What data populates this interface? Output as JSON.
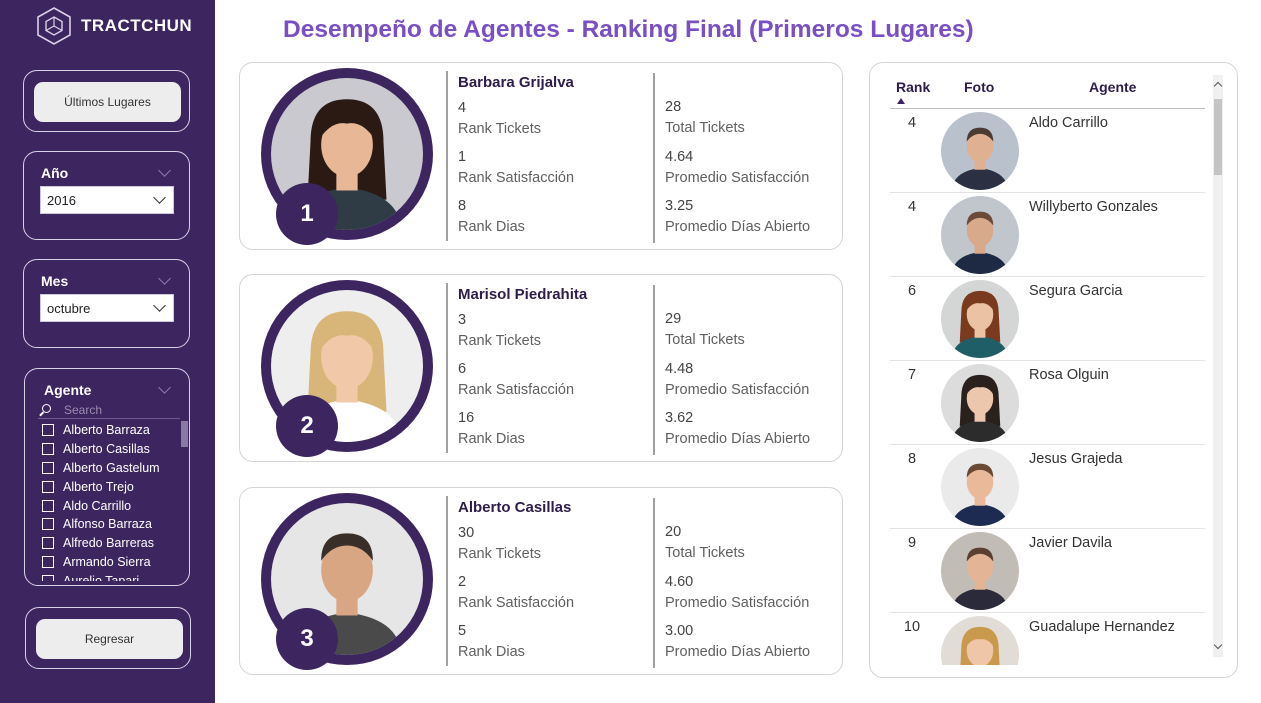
{
  "brand": {
    "name": "TRACTCHUN"
  },
  "sidebar": {
    "ultimos_label": "Últimos Lugares",
    "anio": {
      "title": "Año",
      "value": "2016"
    },
    "mes": {
      "title": "Mes",
      "value": "octubre"
    },
    "agente": {
      "title": "Agente",
      "search_placeholder": "Search",
      "items": [
        "Alberto Barraza",
        "Alberto Casillas",
        "Alberto Gastelum",
        "Alberto Trejo",
        "Aldo Carrillo",
        "Alfonso Barraza",
        "Alfredo Barreras",
        "Armando Sierra",
        "Aurelio Tapari"
      ]
    },
    "regresar_label": "Regresar"
  },
  "title": "Desempeño de Agentes - Ranking Final (Primeros Lugares)",
  "cards": [
    {
      "place": "1",
      "name": "Barbara Grijalva",
      "rank_tickets": "4",
      "rank_tickets_label": "Rank Tickets",
      "rank_sat": "1",
      "rank_sat_label": "Rank Satisfacción",
      "rank_dias": "8",
      "rank_dias_label": "Rank Dias",
      "total_tickets": "28",
      "total_tickets_label": "Total Tickets",
      "prom_sat": "4.64",
      "prom_sat_label": "Promedio Satisfacción",
      "prom_dias": "3.25",
      "prom_dias_label": "Promedio Días Abierto"
    },
    {
      "place": "2",
      "name": "Marisol Piedrahita",
      "rank_tickets": "3",
      "rank_tickets_label": "Rank Tickets",
      "rank_sat": "6",
      "rank_sat_label": "Rank Satisfacción",
      "rank_dias": "16",
      "rank_dias_label": "Rank Dias",
      "total_tickets": "29",
      "total_tickets_label": "Total Tickets",
      "prom_sat": "4.48",
      "prom_sat_label": "Promedio Satisfacción",
      "prom_dias": "3.62",
      "prom_dias_label": "Promedio Días Abierto"
    },
    {
      "place": "3",
      "name": "Alberto Casillas",
      "rank_tickets": "30",
      "rank_tickets_label": "Rank Tickets",
      "rank_sat": "2",
      "rank_sat_label": "Rank Satisfacción",
      "rank_dias": "5",
      "rank_dias_label": "Rank Dias",
      "total_tickets": "20",
      "total_tickets_label": "Total Tickets",
      "prom_sat": "4.60",
      "prom_sat_label": "Promedio Satisfacción",
      "prom_dias": "3.00",
      "prom_dias_label": "Promedio Días Abierto"
    }
  ],
  "table": {
    "headers": {
      "rank": "Rank",
      "foto": "Foto",
      "agente": "Agente"
    },
    "rows": [
      {
        "rank": "4",
        "agente": "Aldo Carrillo"
      },
      {
        "rank": "4",
        "agente": "Willyberto Gonzales"
      },
      {
        "rank": "6",
        "agente": "Segura Garcia"
      },
      {
        "rank": "7",
        "agente": "Rosa Olguin"
      },
      {
        "rank": "8",
        "agente": "Jesus Grajeda"
      },
      {
        "rank": "9",
        "agente": "Javier Davila"
      },
      {
        "rank": "10",
        "agente": "Guadalupe Hernandez"
      }
    ]
  },
  "colors": {
    "sidebar": "#3d2560",
    "title": "#7a4fc4",
    "accent": "#3d2560"
  }
}
